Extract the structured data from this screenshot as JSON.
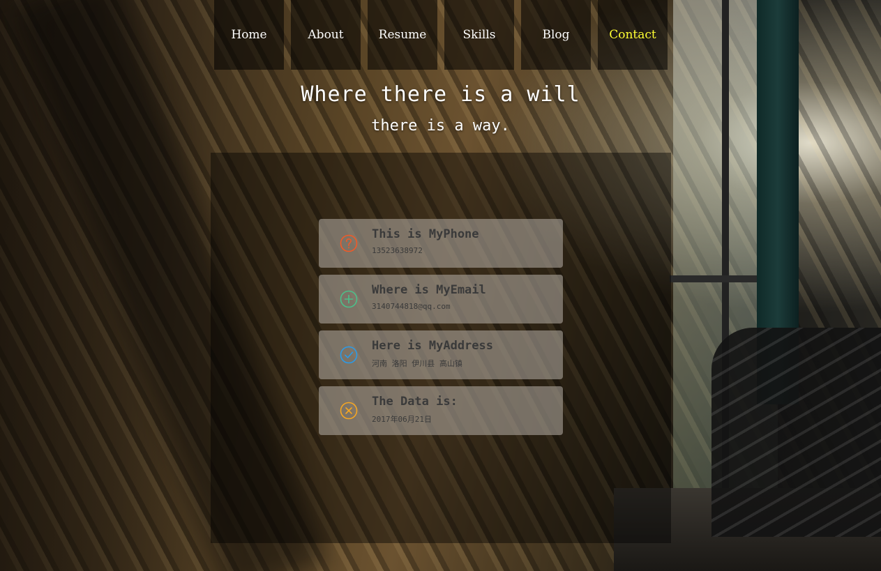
{
  "nav": {
    "items": [
      {
        "label": "Home"
      },
      {
        "label": "About"
      },
      {
        "label": "Resume"
      },
      {
        "label": "Skills"
      },
      {
        "label": "Blog"
      },
      {
        "label": "Contact"
      }
    ],
    "active": "Contact",
    "active_color": "#ffff33"
  },
  "hero": {
    "headline": "Where there is a will",
    "subline": "there is a way."
  },
  "contact": {
    "cards": [
      {
        "title": "This is MyPhone",
        "value": "13523638972",
        "icon": "question-circle-icon",
        "icon_color": "#f05a28"
      },
      {
        "title": "Where is MyEmail",
        "value": "3140744818@qq.com",
        "icon": "plus-circle-icon",
        "icon_color": "#4cc08a"
      },
      {
        "title": "Here is MyAddress",
        "value": "河南 洛阳 伊川县 高山镇",
        "icon": "check-circle-icon",
        "icon_color": "#2b9be8"
      },
      {
        "title": "The Data is:",
        "value": "2017年06月21日",
        "icon": "x-circle-icon",
        "icon_color": "#f5a623"
      }
    ]
  }
}
